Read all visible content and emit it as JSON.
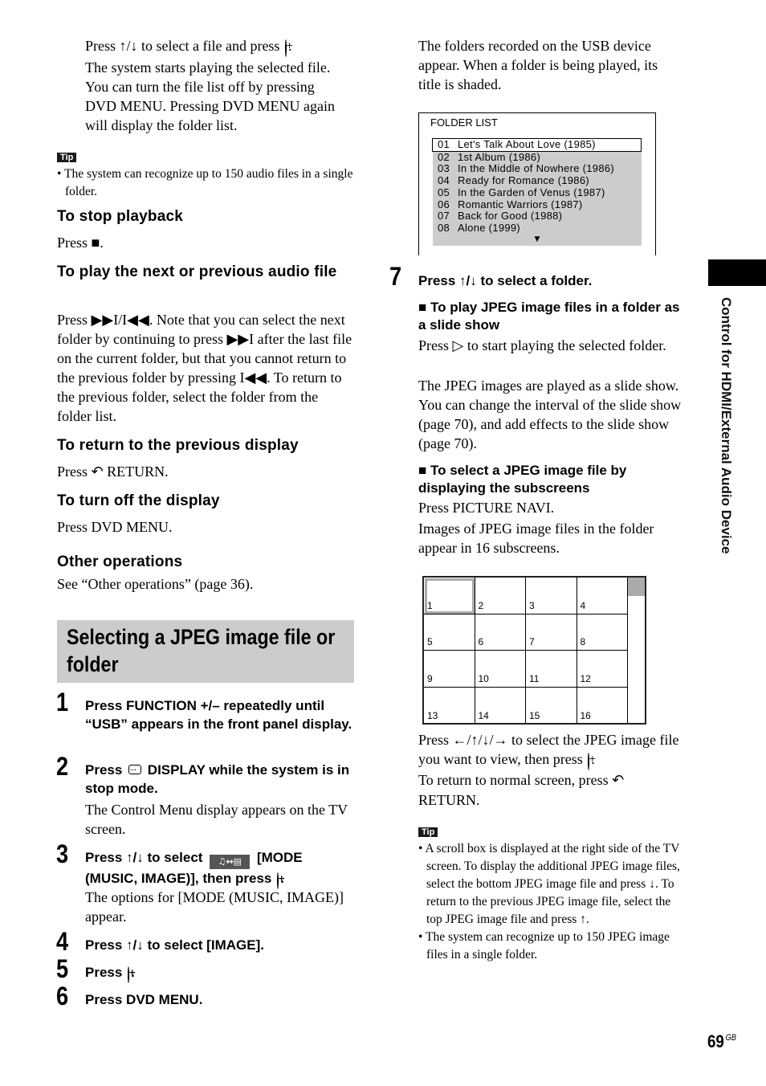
{
  "left_column": {
    "intro_paragraph": [
      "Press ↑/↓ to select a file and press",
      "The system starts playing the selected file.",
      "You can turn the file list off by pressing",
      "DVD MENU. Pressing DVD MENU again",
      "will display the folder list."
    ],
    "tip1": {
      "badge": "Tip",
      "items": [
        "The system can recognize up to 150 audio files in a single folder."
      ]
    },
    "stop_playback": {
      "heading": "To stop playback",
      "body": "Press ■."
    },
    "next_prev": {
      "heading": "To play the next or previous audio file",
      "body": "Press ▶▶I/I◀◀. Note that you can select the next folder by continuing to press ▶▶I after the last file on the current folder, but that you cannot return to the previous folder by pressing I◀◀. To return to the previous folder, select the folder from the folder list."
    },
    "return_display": {
      "heading": "To return to the previous display",
      "body_prefix": "Press",
      "body_suffix": "RETURN."
    },
    "turn_off_display": {
      "heading": "To turn off the display",
      "body": "Press DVD MENU."
    },
    "other_operations": {
      "heading": "Other operations",
      "body": "See “Other operations” (page 36)."
    },
    "section_title": "Selecting a JPEG image file or folder",
    "steps": [
      {
        "num": "1",
        "text": "Press FUNCTION +/– repeatedly until “USB” appears in the front panel display."
      },
      {
        "num": "2",
        "text_prefix": "Press",
        "text_suffix": "DISPLAY while the system is in stop mode.",
        "body": "The Control Menu display appears on the TV screen."
      },
      {
        "num": "3",
        "text_prefix": "Press ↑/↓ to select",
        "mode_icon": "♫↔▤",
        "text_suffix": "[MODE (MUSIC, IMAGE)], then press",
        "body": "The options for [MODE (MUSIC, IMAGE)] appear."
      },
      {
        "num": "4",
        "text": "Press ↑/↓ to select [IMAGE]."
      },
      {
        "num": "5",
        "text": "Press"
      },
      {
        "num": "6",
        "text": "Press DVD MENU."
      }
    ]
  },
  "right_column": {
    "intro_paragraph": "The folders recorded on the USB device appear. When a folder is being played, its title is shaded.",
    "folder_list": {
      "title": "FOLDER LIST",
      "selected_index": 0,
      "items": [
        {
          "num": "01",
          "name": "Let's Talk About Love (1985)"
        },
        {
          "num": "02",
          "name": "1st Album (1986)"
        },
        {
          "num": "03",
          "name": "In the Middle of Nowhere (1986)"
        },
        {
          "num": "04",
          "name": "Ready for Romance (1986)"
        },
        {
          "num": "05",
          "name": "In the Garden of Venus (1987)"
        },
        {
          "num": "06",
          "name": "Romantic Warriors (1987)"
        },
        {
          "num": "07",
          "name": "Back for Good (1988)"
        },
        {
          "num": "08",
          "name": "Alone (1999)"
        }
      ],
      "more_indicator": "▼"
    },
    "step7": {
      "num": "7",
      "text": "Press ↑/↓ to select a folder."
    },
    "slide_show": {
      "heading": "■ To play JPEG image files in a folder as a slide show",
      "body1": "Press ▷ to start playing the selected folder.",
      "body2": "The JPEG images are played as a slide show. You can change the interval of the slide show (page 70), and add effects to the slide show (page 70)."
    },
    "subscreens": {
      "heading": "■ To select a JPEG image file by displaying the subscreens",
      "body1": "Press PICTURE NAVI.",
      "body2": "Images of JPEG image files in the folder appear in 16 subscreens."
    },
    "grid": {
      "cells": [
        "1",
        "2",
        "3",
        "4",
        "5",
        "6",
        "7",
        "8",
        "9",
        "10",
        "11",
        "12",
        "13",
        "14",
        "15",
        "16"
      ],
      "selected_index": 0
    },
    "after_grid": {
      "para1_prefix": "Press ←/↑/↓/→ to select the JPEG image file you want to view, then press",
      "para2_prefix": "To return to normal screen, press",
      "para2_suffix": "RETURN."
    },
    "tip2": {
      "badge": "Tip",
      "items": [
        "A scroll box is displayed at the right side of the TV screen. To display the additional JPEG image files, select the bottom JPEG image file and press ↓. To return to the previous JPEG image file, select the top JPEG image file and press ↑.",
        "The system can recognize up to 150 JPEG image files in a single folder."
      ]
    }
  },
  "side_tab": {
    "label": "Control for HDMI/External Audio Device"
  },
  "footer": {
    "page_number": "69",
    "page_suffix": "GB"
  }
}
